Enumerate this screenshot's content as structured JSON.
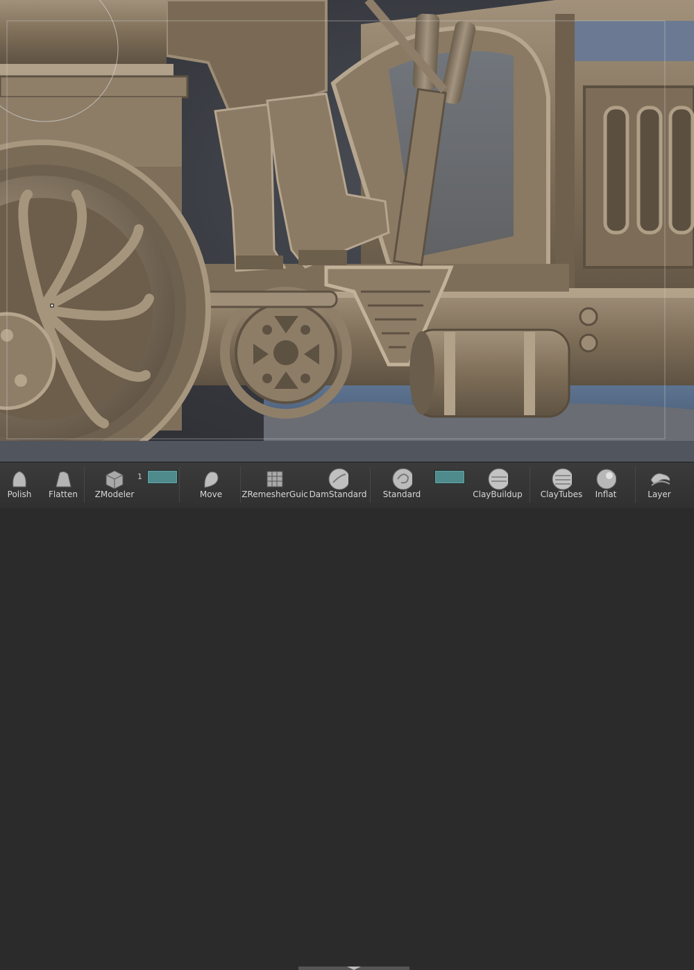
{
  "toolbar": {
    "brushes": [
      {
        "label": "Polish",
        "icon": "polish-brush-icon"
      },
      {
        "label": "Flatten",
        "icon": "flatten-brush-icon"
      },
      {
        "label": "ZModeler",
        "icon": "zmodeler-brush-icon"
      },
      {
        "label": "Move",
        "icon": "move-brush-icon"
      },
      {
        "label": "ZRemesherGuic",
        "icon": "zremesher-guide-brush-icon"
      },
      {
        "label": "DamStandard",
        "icon": "damstandard-brush-icon"
      },
      {
        "label": "Standard",
        "icon": "standard-brush-icon"
      },
      {
        "label": "ClayBuildup",
        "icon": "claybuildup-brush-icon"
      },
      {
        "label": "ClayTubes",
        "icon": "claytubes-brush-icon"
      },
      {
        "label": "Inflat",
        "icon": "inflat-brush-icon"
      },
      {
        "label": "Layer",
        "icon": "layer-brush-icon"
      }
    ],
    "slot_number": "1",
    "slot_color": "#4f8a8c"
  },
  "viewport": {
    "subject": "sculpted vehicle with seated figure",
    "material_color": "#8b7a63",
    "background_color": "#3a3c42"
  }
}
